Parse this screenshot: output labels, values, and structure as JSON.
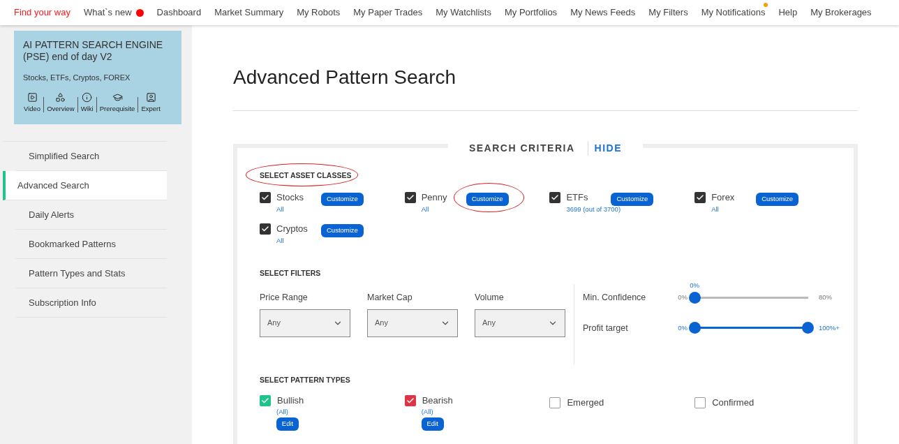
{
  "nav": [
    {
      "label": "Find your way",
      "selected": true
    },
    {
      "label": "What`s new",
      "selected": false,
      "badge": {
        "kind": "dot",
        "color": "#ff0000"
      }
    },
    {
      "label": "Dashboard",
      "selected": false
    },
    {
      "label": "Market Summary",
      "selected": false
    },
    {
      "label": "My Robots",
      "selected": false
    },
    {
      "label": "My Paper Trades",
      "selected": false
    },
    {
      "label": "My Watchlists",
      "selected": false
    },
    {
      "label": "My Portfolios",
      "selected": false
    },
    {
      "label": "My News Feeds",
      "selected": false
    },
    {
      "label": "My Filters",
      "selected": false
    },
    {
      "label": "My Notifications",
      "selected": false,
      "badge": {
        "kind": "corner-dot",
        "color": "#f59e0b"
      }
    },
    {
      "label": "Help",
      "selected": false
    },
    {
      "label": "My Brokerages",
      "selected": false
    }
  ],
  "product_card": {
    "title": "AI PATTERN SEARCH ENGINE (PSE) end of day V2",
    "subtitle": "Stocks, ETFs, Cryptos, FOREX",
    "links": [
      "Video",
      "Overview",
      "Wiki",
      "Prerequisite",
      "Expert"
    ]
  },
  "sidebar": {
    "items": [
      {
        "label": "Simplified Search",
        "selected": false
      },
      {
        "label": "Advanced Search",
        "selected": true
      },
      {
        "label": "Daily Alerts",
        "selected": false
      },
      {
        "label": "Bookmarked Patterns",
        "selected": false
      },
      {
        "label": "Pattern Types and Stats",
        "selected": false
      },
      {
        "label": "Subscription Info",
        "selected": false
      }
    ]
  },
  "page_title": "Advanced Pattern Search",
  "search_criteria": {
    "title": "SEARCH CRITERIA",
    "toggle": "HIDE",
    "asset_classes": {
      "heading": "SELECT ASSET CLASSES",
      "circled": true,
      "items": [
        {
          "label": "Stocks",
          "checked": true,
          "button": "Customize",
          "detail": "All",
          "circled": false
        },
        {
          "label": "Penny",
          "checked": true,
          "button": "Customize",
          "detail": "All",
          "circled": true
        },
        {
          "label": "ETFs",
          "checked": true,
          "button": "Customize",
          "detail": "3699 (out of 3700)",
          "circled": false
        },
        {
          "label": "Forex",
          "checked": true,
          "button": "Customize",
          "detail": "All",
          "circled": false
        },
        {
          "label": "Cryptos",
          "checked": true,
          "button": "Customize",
          "detail": "All",
          "circled": false
        }
      ]
    },
    "filters": {
      "heading": "SELECT FILTERS",
      "dropdowns": [
        {
          "label": "Price Range",
          "value": "Any"
        },
        {
          "label": "Market Cap",
          "value": "Any"
        },
        {
          "label": "Volume",
          "value": "Any"
        }
      ],
      "sliders": [
        {
          "kind": "single",
          "label": "Min. Confidence",
          "min_label": "0%",
          "max_label": "80%",
          "value_label": "0%",
          "level": 0
        },
        {
          "kind": "range",
          "label": "Profit target",
          "min_label": "0%",
          "max_label": "100%+",
          "level": 1
        }
      ]
    },
    "pattern_types": {
      "heading": "SELECT PATTERN TYPES",
      "items": [
        {
          "label": "Bullish",
          "checked": true,
          "color": "#1fc48b",
          "detail": "(All)",
          "button": "Edit"
        },
        {
          "label": "Bearish",
          "checked": true,
          "color": "#dc3545",
          "detail": "(All)",
          "button": "Edit"
        },
        {
          "label": "Emerged",
          "checked": false
        },
        {
          "label": "Confirmed",
          "checked": false
        }
      ]
    }
  }
}
